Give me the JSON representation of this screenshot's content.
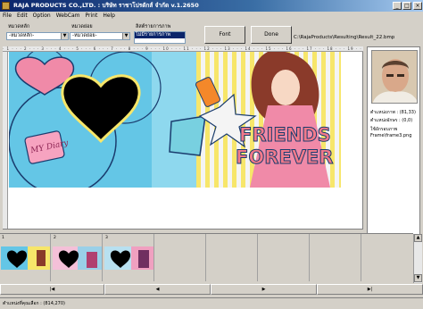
{
  "window": {
    "title": "RAJA PRODUCTS CO.,LTD.  : บริษัท ราชาโปรดักส์ จำกัด v.1.2650",
    "min_label": "_",
    "max_label": "□",
    "close_label": "×"
  },
  "menu": [
    "File",
    "Edit",
    "Option",
    "WebCam",
    "Print",
    "Help"
  ],
  "controls": {
    "category_label": "หมวดหลัก",
    "category_value": "-หมวดหลัก-",
    "subcategory_label": "หมวดย่อย",
    "subcategory_value": "-หมวดย่อย-",
    "list_label": "ลิสต์รายการภาพ",
    "list_selected": "ไม่มีรายการภาพ",
    "font_button": "Font",
    "done_button": "Done",
    "result_path": "C:\\RajaProducts\\Resulting\\Result_22.bmp"
  },
  "ruler": {
    "ticks": "· 1 · · · 2 · · · 3 · · · 4 · · · 5 · · · 6 · · · 7 · · · 8 · · · 9 · · · 10 · · · 11 · · · 12 · · · 13 · · · 14 · · · 15 · · · 16 · · · 17 · · · 18 · · · 19 · · · 20 · · · 21 · · · 22 · · · 23 · · · 24 · · · 25 · · · 26 · · · 27"
  },
  "design": {
    "text_line1": "FRIENDS",
    "text_line2": "FOREVER",
    "sticker_text": "MY Diary"
  },
  "info_panel": {
    "position": "ตำแหน่งภาพ : (81,33)",
    "char_position": "ตำแหน่งอักษร : (0,0)",
    "frame_label": "ใช้อักรอบภาพ",
    "frame_file": "Frame\\frame3.png"
  },
  "thumbnails": [
    {
      "label": "1",
      "has_image": true
    },
    {
      "label": "2",
      "has_image": true
    },
    {
      "label": "3",
      "has_image": true
    },
    {
      "label": "",
      "has_image": false
    },
    {
      "label": "",
      "has_image": false
    },
    {
      "label": "",
      "has_image": false
    },
    {
      "label": "",
      "has_image": false
    },
    {
      "label": "",
      "has_image": false
    }
  ],
  "nav": {
    "first": "|◀",
    "prev": "◀",
    "next": "▶",
    "last": "▶|"
  },
  "status": {
    "text": "ตำแหน่งที่คุณเลือก : (814,270)"
  },
  "colors": {
    "titlebar": "#0a246a",
    "face": "#d4d0c8",
    "selection": "#0a246a",
    "heart": "#000000",
    "friends_text": "#f27a8a",
    "banner_blue": "#64c6e6"
  }
}
